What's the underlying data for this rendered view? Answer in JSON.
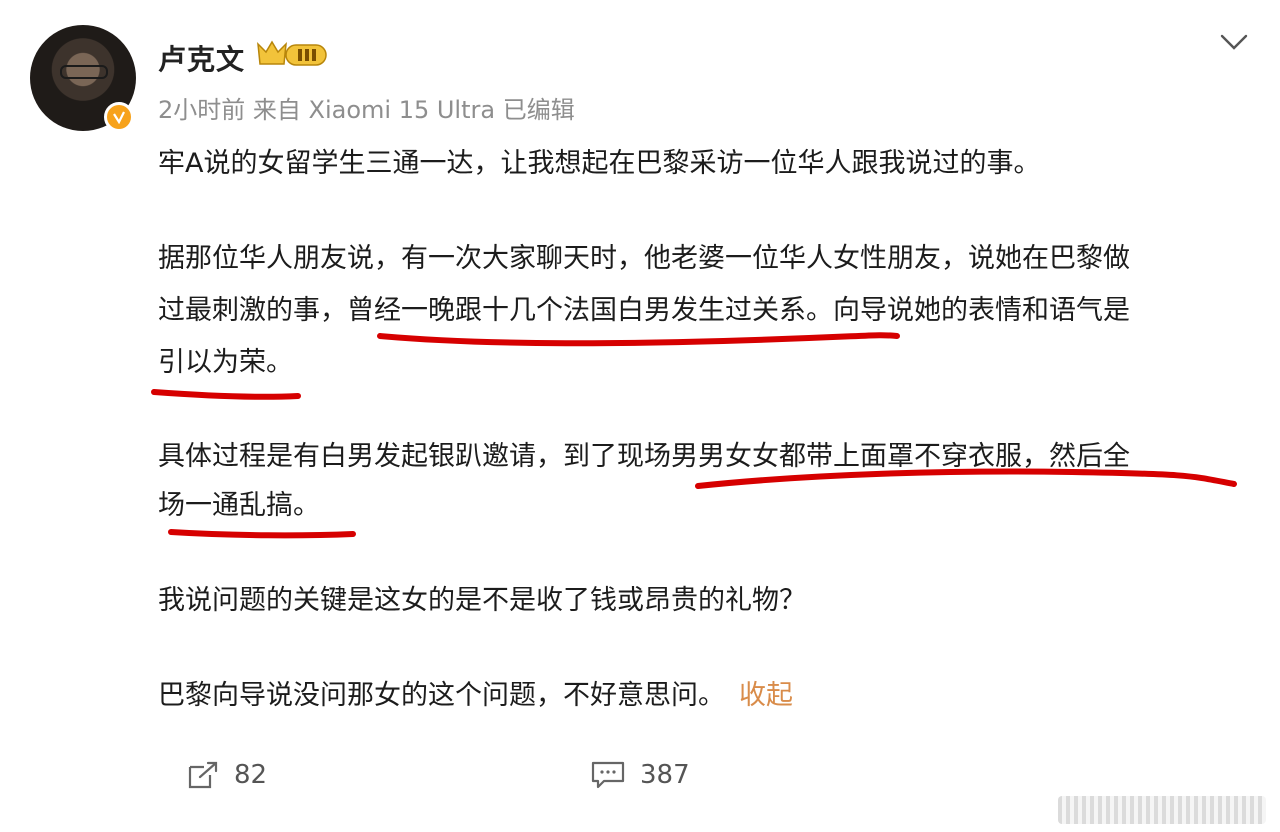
{
  "post": {
    "author": "卢克文",
    "time_source": "2小时前 来自 Xiaomi 15 Ultra 已编辑",
    "paragraphs": [
      "牢A说的女留学生三通一达，让我想起在巴黎采访一位华人跟我说过的事。",
      "据那位华人朋友说，有一次大家聊天时，他老婆一位华人女性朋友，说她在巴黎做",
      "过最刺激的事，曾经一晚跟十几个法国白男发生过关系。向导说她的表情和语气是",
      "引以为荣。",
      "具体过程是有白男发起银趴邀请，到了现场男男女女都带上面罩不穿衣服，然后全",
      "场一通乱搞。",
      "我说问题的关键是这女的是不是收了钱或昂贵的礼物？",
      "巴黎向导说没问那女的这个问题，不好意思问。"
    ],
    "collapse_label": "收起",
    "repost_count": "82",
    "comment_count": "387"
  },
  "colors": {
    "accent": "#d98c4a",
    "underline": "#d60000",
    "verified": "#f7a21b",
    "meta_text": "#8e8e8e"
  },
  "icons": [
    "verified-badge-icon",
    "crown-level-badge-icon",
    "chevron-down-icon",
    "repost-icon",
    "comment-icon"
  ]
}
